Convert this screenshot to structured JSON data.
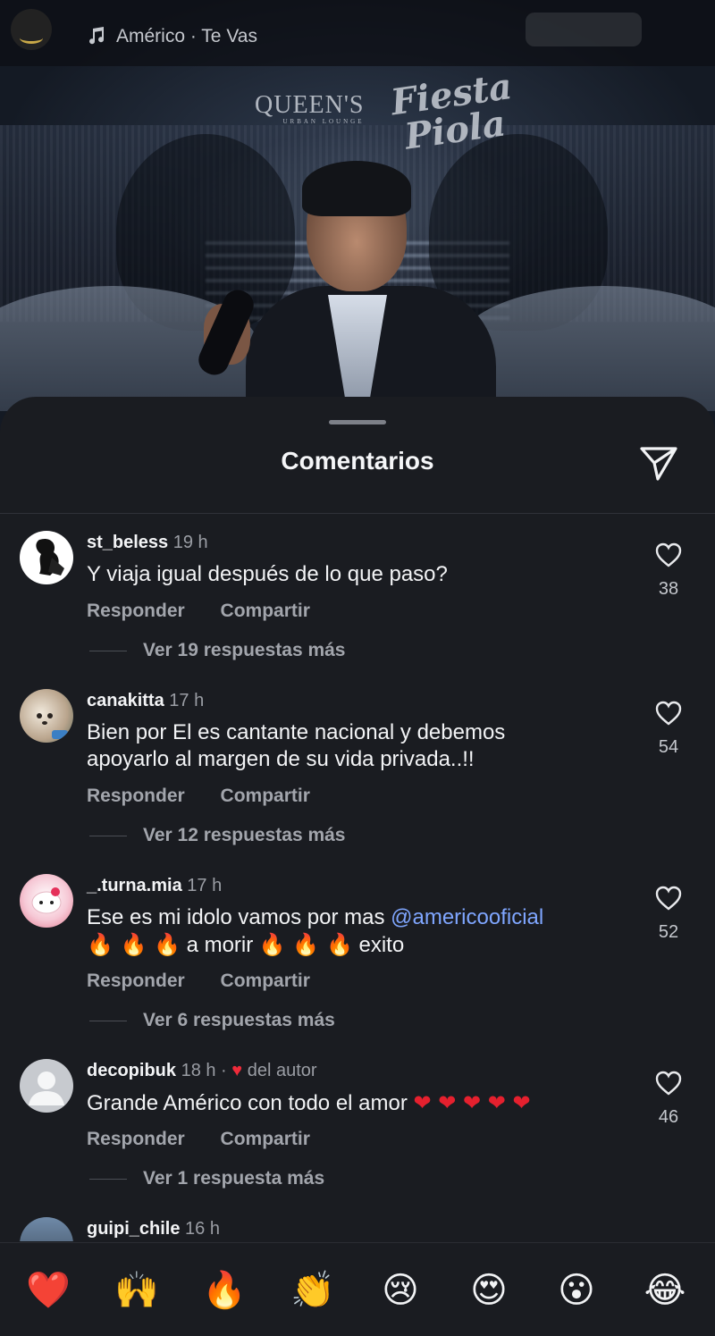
{
  "top_bar": {
    "song": "Américo · Te Vas"
  },
  "media": {
    "logo_left": "QUEEN'S",
    "logo_left_sub": "URBAN LOUNGE",
    "logo_right_line1": "Fiesta",
    "logo_right_line2": "Piola"
  },
  "sheet": {
    "title": "Comentarios"
  },
  "comments": [
    {
      "user": "st_beless",
      "time": "19 h",
      "text": "Y viaja igual después de lo que paso?",
      "reply": "Responder",
      "share": "Compartir",
      "likes": "38",
      "replies": "Ver 19 respuestas más"
    },
    {
      "user": "canakitta",
      "time": "17 h",
      "text_line1": "Bien por El es cantante nacional y debemos",
      "text_line2": "apoyarlo al margen de su vida privada..!!",
      "reply": "Responder",
      "share": "Compartir",
      "likes": "54",
      "replies": "Ver 12 respuestas más"
    },
    {
      "user": "_.turna.mia",
      "time": "17 h",
      "text_prefix": "Ese es mi idolo vamos por mas ",
      "mention": "@americooficial",
      "text_mid": "a morir",
      "text_end": "exito",
      "reply": "Responder",
      "share": "Compartir",
      "likes": "52",
      "replies": "Ver 6 respuestas más"
    },
    {
      "user": "decopibuk",
      "time": "18 h ·",
      "author_like": "del autor",
      "text": "Grande Américo con todo el amor",
      "reply": "Responder",
      "share": "Compartir",
      "likes": "46",
      "replies": "Ver 1 respuesta más"
    },
    {
      "user": "guipi_chile",
      "time": "16 h"
    }
  ],
  "emoji_bar": [
    "❤️",
    "🙌",
    "🔥",
    "👏",
    "😢",
    "😍",
    "😮",
    "😂"
  ],
  "colors": {
    "sheet_bg": "#1a1c21",
    "mention": "#7fa6ff",
    "author_heart": "#ef2b3a"
  }
}
